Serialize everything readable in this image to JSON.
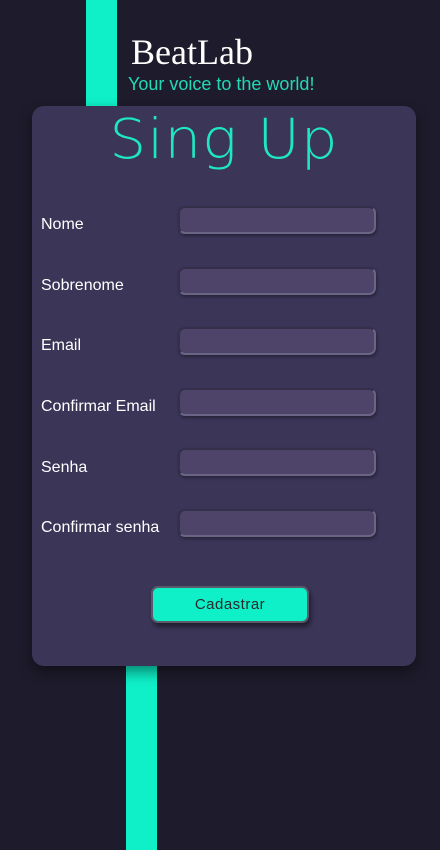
{
  "header": {
    "brand": "BeatLab",
    "tagline": "Your voice to the world!"
  },
  "form": {
    "title": "Sing Up",
    "fields": [
      {
        "label": "Nome",
        "value": ""
      },
      {
        "label": "Sobrenome",
        "value": ""
      },
      {
        "label": "Email",
        "value": ""
      },
      {
        "label": "Confirmar Email",
        "value": ""
      },
      {
        "label": "Senha",
        "value": ""
      },
      {
        "label": "Confirmar senha",
        "value": ""
      }
    ],
    "submit_label": "Cadastrar"
  },
  "colors": {
    "background": "#1e1c2c",
    "accent": "#0ff0c8",
    "card": "#3b3558",
    "input": "#4e4469",
    "tagline": "#23d9b5"
  }
}
